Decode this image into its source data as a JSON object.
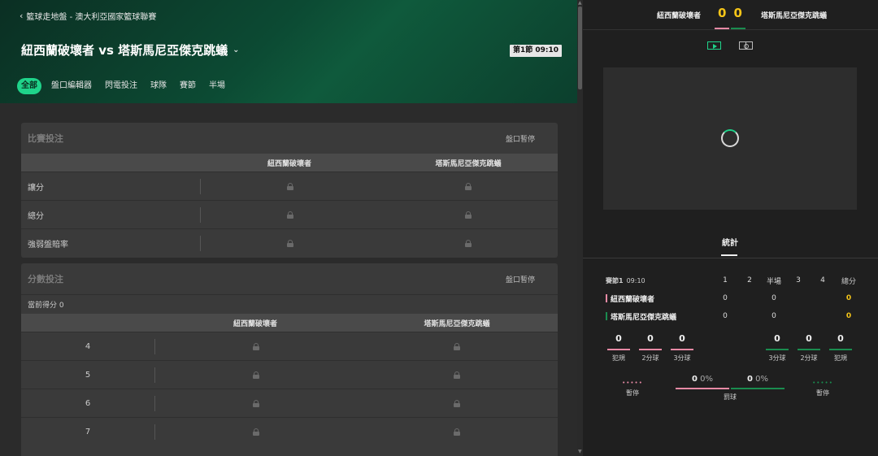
{
  "colors": {
    "accent": "#1fd38a",
    "home": "#e78aa5",
    "away": "#1a8c4f",
    "score": "#f5c518"
  },
  "breadcrumb": "籃球走地盤 - 澳大利亞國家籃球聯賽",
  "match": {
    "title": "紐西蘭破壞者 vs 塔斯馬尼亞傑克跳蟻",
    "clock": "第1節 09:10"
  },
  "tabs": [
    "全部",
    "盤口編輯器",
    "閃電投注",
    "球隊",
    "賽節",
    "半場"
  ],
  "market1": {
    "title": "比賽投注",
    "status": "盤口暫停",
    "home": "紐西蘭破壞者",
    "away": "塔斯馬尼亞傑克跳蟻",
    "rows": [
      "讓分",
      "總分",
      "強弱盤賠率"
    ]
  },
  "market2": {
    "title": "分數投注",
    "status": "盤口暫停",
    "current": "當前得分 0",
    "home": "紐西蘭破壞者",
    "away": "塔斯馬尼亞傑克跳蟻",
    "rows": [
      "4",
      "5",
      "6",
      "7"
    ]
  },
  "scoreboard": {
    "home": "紐西蘭破壞者",
    "away": "塔斯馬尼亞傑克跳蟻",
    "home_score": "0",
    "away_score": "0"
  },
  "icons": {
    "video": "video-play-icon",
    "court": "court-icon"
  },
  "stats": {
    "tab": "統計",
    "period": "賽節1",
    "time": "09:10",
    "cols": [
      "1",
      "2",
      "半場",
      "3",
      "4",
      "總分"
    ],
    "home": {
      "name": "紐西蘭破壞者",
      "q1": "0",
      "half": "0",
      "total": "0"
    },
    "away": {
      "name": "塔斯馬尼亞傑克跳蟻",
      "q1": "0",
      "half": "0",
      "total": "0"
    },
    "home_stats": [
      {
        "v": "0",
        "l": "犯規"
      },
      {
        "v": "0",
        "l": "2分球"
      },
      {
        "v": "0",
        "l": "3分球"
      }
    ],
    "away_stats": [
      {
        "v": "0",
        "l": "3分球"
      },
      {
        "v": "0",
        "l": "2分球"
      },
      {
        "v": "0",
        "l": "犯規"
      }
    ],
    "pause_label": "暫停",
    "free_throw": {
      "home_made": "0",
      "home_pct": "0%",
      "away_made": "0",
      "away_pct": "0%",
      "label": "罰球"
    }
  }
}
